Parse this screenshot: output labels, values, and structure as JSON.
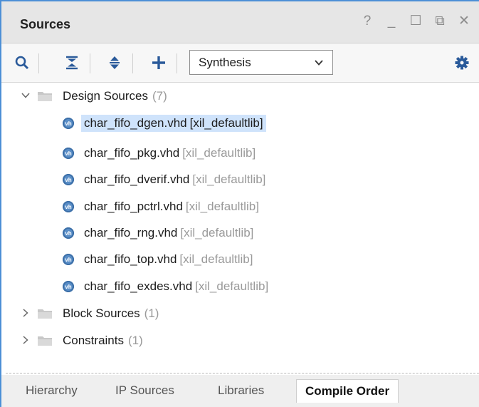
{
  "panel": {
    "title": "Sources"
  },
  "window_controls": [
    "?",
    "_",
    "☐",
    "⧉",
    "✕"
  ],
  "toolbar": {
    "icons": [
      "search-icon",
      "collapse-all-icon",
      "expand-all-icon",
      "add-icon"
    ],
    "view_select": {
      "value": "Synthesis"
    },
    "settings_icon": "gear-icon"
  },
  "tree": {
    "design_sources": {
      "label": "Design Sources",
      "count": "(7)"
    },
    "files": [
      {
        "name": "char_fifo_dgen.vhd",
        "lib": "[xil_defaultlib]"
      },
      {
        "name": "char_fifo_pkg.vhd",
        "lib": "[xil_defaultlib]"
      },
      {
        "name": "char_fifo_dverif.vhd",
        "lib": "[xil_defaultlib]"
      },
      {
        "name": "char_fifo_pctrl.vhd",
        "lib": "[xil_defaultlib]"
      },
      {
        "name": "char_fifo_rng.vhd",
        "lib": "[xil_defaultlib]"
      },
      {
        "name": "char_fifo_top.vhd",
        "lib": "[xil_defaultlib]"
      },
      {
        "name": "char_fifo_exdes.vhd",
        "lib": "[xil_defaultlib]"
      }
    ],
    "file_icon_text": "vh",
    "block_sources": {
      "label": "Block Sources",
      "count": "(1)"
    },
    "constraints": {
      "label": "Constraints",
      "count": "(1)"
    }
  },
  "tabs": [
    "Hierarchy",
    "IP Sources",
    "Libraries",
    "Compile Order"
  ],
  "colors": {
    "accent": "#4c8fd6",
    "selection": "#cfe3fb",
    "file_icon": "#5a8ec7"
  }
}
